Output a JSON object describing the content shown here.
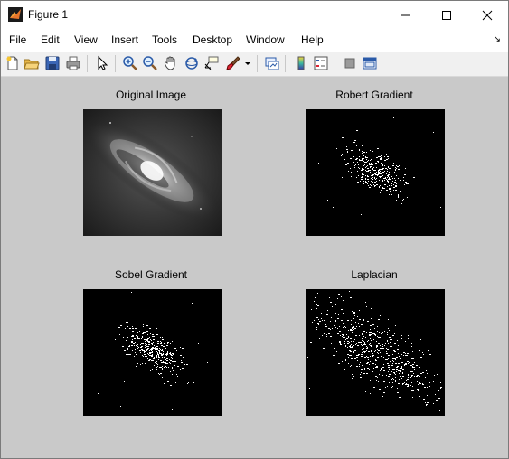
{
  "window": {
    "title": "Figure 1"
  },
  "menu": {
    "items": [
      "File",
      "Edit",
      "View",
      "Insert",
      "Tools",
      "Desktop",
      "Window",
      "Help"
    ]
  },
  "toolbar": {
    "buttons": [
      "new-figure",
      "open-file",
      "save",
      "print",
      "edit-plot",
      "zoom-in",
      "zoom-out",
      "pan",
      "rotate-3d",
      "data-cursor",
      "brush",
      "link-plot",
      "colorbar",
      "legend",
      "hide-plot-tools",
      "show-plot-tools"
    ]
  },
  "plots": [
    {
      "title": "Original Image"
    },
    {
      "title": "Robert Gradient"
    },
    {
      "title": "Sobel Gradient"
    },
    {
      "title": "Laplacian"
    }
  ],
  "colors": {
    "figure_bg": "#c9c9c9",
    "toolbar_bg": "#f0f0f0",
    "image_bg": "#000000"
  }
}
